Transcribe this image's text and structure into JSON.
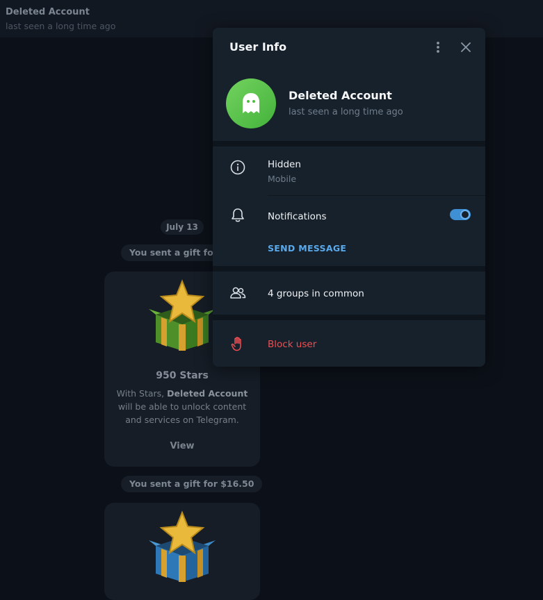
{
  "chat_header": {
    "title": "Deleted Account",
    "status": "last seen a long time ago"
  },
  "chat": {
    "date": "July 13",
    "gifts": [
      {
        "service_text": "You sent a gift for $",
        "title": "950 Stars",
        "desc_prefix": "With Stars, ",
        "desc_name": "Deleted Account",
        "desc_suffix": " will be able to unlock content and services on Telegram.",
        "view_label": "View",
        "box_color": "green"
      },
      {
        "service_text": "You sent a gift for $16.50",
        "box_color": "blue"
      }
    ]
  },
  "modal": {
    "title": "User Info",
    "menu_icon": "more-vertical-icon",
    "close_icon": "close-icon",
    "profile": {
      "name": "Deleted Account",
      "status": "last seen a long time ago",
      "avatar_icon": "ghost-icon",
      "avatar_color": "#5cc64b"
    },
    "info": {
      "value": "Hidden",
      "label": "Mobile"
    },
    "notifications": {
      "label": "Notifications",
      "enabled": true
    },
    "send_message": "SEND MESSAGE",
    "groups": "4 groups in common",
    "block": "Block user"
  },
  "colors": {
    "accent": "#5aa9eb",
    "danger": "#ef4f52",
    "panel": "#17212b",
    "background": "#0c1119"
  }
}
